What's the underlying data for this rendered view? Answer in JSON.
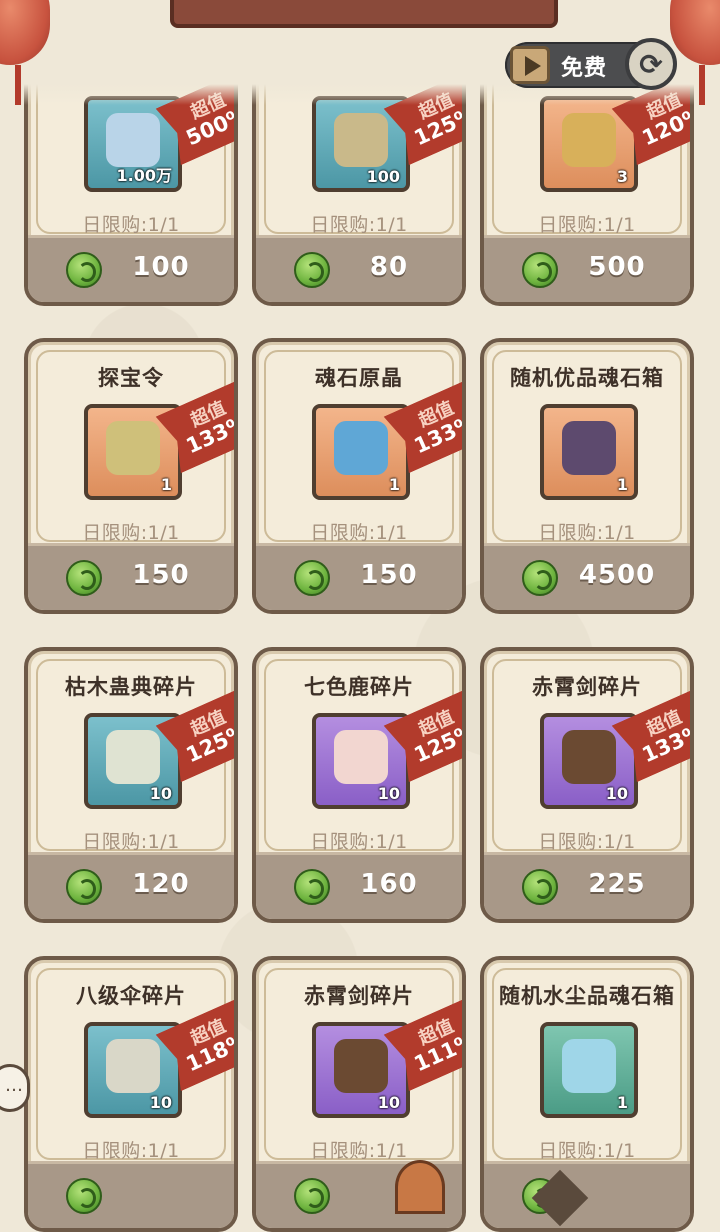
{
  "refresh": {
    "free_label": "免费",
    "refresh_icon": "refresh-icon",
    "video_icon": "play-video-icon"
  },
  "items": [
    {
      "name": "",
      "quantity": "1.00万",
      "limit": "日限购:1/1",
      "price": "100",
      "discount": "500%",
      "badge": "超值",
      "box": "blue",
      "icon_color": "#b9d4e8"
    },
    {
      "name": "",
      "quantity": "100",
      "limit": "日限购:1/1",
      "price": "80",
      "discount": "125%",
      "badge": "超值",
      "box": "blue",
      "icon_color": "#c9b98a"
    },
    {
      "name": "",
      "quantity": "3",
      "limit": "日限购:1/1",
      "price": "500",
      "discount": "120%",
      "badge": "超值",
      "box": "orange",
      "icon_color": "#d8b05a"
    },
    {
      "name": "探宝令",
      "quantity": "1",
      "limit": "日限购:1/1",
      "price": "150",
      "discount": "133%",
      "badge": "超值",
      "box": "orange",
      "icon_color": "#cfc07a"
    },
    {
      "name": "魂石原晶",
      "quantity": "1",
      "limit": "日限购:1/1",
      "price": "150",
      "discount": "133%",
      "badge": "超值",
      "box": "orange",
      "icon_color": "#5fa7d6"
    },
    {
      "name": "随机优品魂石箱",
      "quantity": "1",
      "limit": "日限购:1/1",
      "price": "4500",
      "discount": "",
      "badge": "",
      "box": "orange",
      "icon_color": "#5d4a6e"
    },
    {
      "name": "枯木蛊典碎片",
      "quantity": "10",
      "limit": "日限购:1/1",
      "price": "120",
      "discount": "125%",
      "badge": "超值",
      "box": "blue",
      "icon_color": "#dfe3d2"
    },
    {
      "name": "七色鹿碎片",
      "quantity": "10",
      "limit": "日限购:1/1",
      "price": "160",
      "discount": "125%",
      "badge": "超值",
      "box": "purple",
      "icon_color": "#f2d6d0"
    },
    {
      "name": "赤霄剑碎片",
      "quantity": "10",
      "limit": "日限购:1/1",
      "price": "225",
      "discount": "133%",
      "badge": "超值",
      "box": "purple",
      "icon_color": "#6b4a32"
    },
    {
      "name": "八级伞碎片",
      "quantity": "10",
      "limit": "日限购:1/1",
      "price": "",
      "discount": "118%",
      "badge": "超值",
      "box": "blue",
      "icon_color": "#d9d7c8"
    },
    {
      "name": "赤霄剑碎片",
      "quantity": "10",
      "limit": "日限购:1/1",
      "price": "",
      "discount": "111%",
      "badge": "超值",
      "box": "purple",
      "icon_color": "#6b4a32"
    },
    {
      "name": "随机水尘品魂石箱",
      "quantity": "1",
      "limit": "日限购:1/1",
      "price": "",
      "discount": "",
      "badge": "",
      "box": "green",
      "icon_color": "#9fd6e8"
    }
  ],
  "colors": {
    "card_border": "#6e5a48",
    "ribbon": "#b23b2c",
    "price_bar": "#a89888",
    "coin": "#6db33e"
  }
}
